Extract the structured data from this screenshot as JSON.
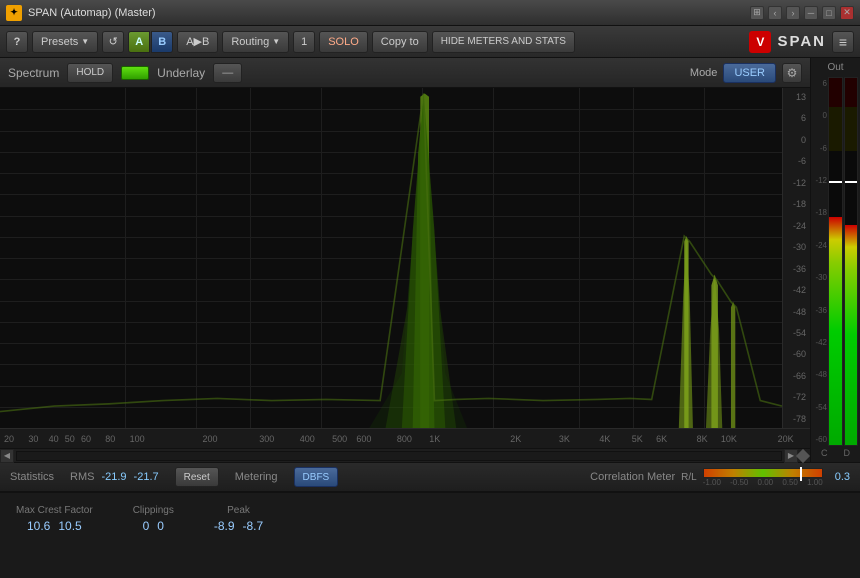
{
  "titleBar": {
    "icon": "✦",
    "title": "SPAN (Automap) (Master)",
    "controls": [
      "grid-icon",
      "back-icon",
      "forward-icon",
      "minimize-icon",
      "restore-icon",
      "close-icon"
    ]
  },
  "toolbar": {
    "help_label": "?",
    "presets_label": "Presets",
    "reset_label": "↺",
    "ab_a": "A",
    "ab_b": "B",
    "ab_arrow": "A▶B",
    "routing_label": "Routing",
    "preset_num": "1",
    "solo_label": "SOLO",
    "copy_label": "Copy to",
    "hide_label": "HIDE METERS AND STATS",
    "logo_letter": "V",
    "plugin_name": "SPAN",
    "menu_icon": "≡"
  },
  "spectrum": {
    "label": "Spectrum",
    "hold_label": "HOLD",
    "underlay_label": "Underlay",
    "underlay_dash": "—",
    "mode_label": "Mode",
    "mode_value": "USER",
    "out_label": "Out"
  },
  "yAxis": {
    "labels": [
      "13",
      "6",
      "0",
      "-6",
      "-12",
      "-18",
      "-24",
      "-30",
      "-36",
      "-42",
      "-48",
      "-54",
      "-60",
      "-66",
      "-72",
      "-78"
    ]
  },
  "xAxis": {
    "labels": [
      {
        "text": "20",
        "pct": 0.5
      },
      {
        "text": "30",
        "pct": 3.5
      },
      {
        "text": "40",
        "pct": 6
      },
      {
        "text": "50",
        "pct": 8
      },
      {
        "text": "60",
        "pct": 10
      },
      {
        "text": "80",
        "pct": 13
      },
      {
        "text": "100",
        "pct": 16
      },
      {
        "text": "200",
        "pct": 25
      },
      {
        "text": "300",
        "pct": 32
      },
      {
        "text": "400",
        "pct": 37
      },
      {
        "text": "500",
        "pct": 41
      },
      {
        "text": "600",
        "pct": 44
      },
      {
        "text": "800",
        "pct": 49
      },
      {
        "text": "1K",
        "pct": 54
      },
      {
        "text": "2K",
        "pct": 63
      },
      {
        "text": "3K",
        "pct": 69
      },
      {
        "text": "4K",
        "pct": 74
      },
      {
        "text": "5K",
        "pct": 78
      },
      {
        "text": "6K",
        "pct": 81
      },
      {
        "text": "8K",
        "pct": 86
      },
      {
        "text": "10K",
        "pct": 90
      },
      {
        "text": "20K",
        "pct": 99
      }
    ]
  },
  "statistics": {
    "label": "Statistics",
    "rms_label": "RMS",
    "rms_l": "-21.9",
    "rms_r": "-21.7",
    "reset_label": "Reset",
    "metering_label": "Metering",
    "dbfs_label": "DBFS",
    "corr_label": "Correlation Meter",
    "rl_label": "R/L",
    "corr_value": "0.3"
  },
  "bottomStats": {
    "crest_title": "Max Crest Factor",
    "crest_l": "10.6",
    "crest_r": "10.5",
    "clip_title": "Clippings",
    "clip_l": "0",
    "clip_r": "0",
    "peak_title": "Peak",
    "peak_l": "-8.9",
    "peak_r": "-8.7"
  },
  "outMeter": {
    "scale": [
      "6",
      "0",
      "-6",
      "-12",
      "-18",
      "-24",
      "-30",
      "-36",
      "-42",
      "-48",
      "-54",
      "-60"
    ],
    "level_l": 65,
    "level_r": 63,
    "peak_l": 72,
    "peak_r": 72
  }
}
